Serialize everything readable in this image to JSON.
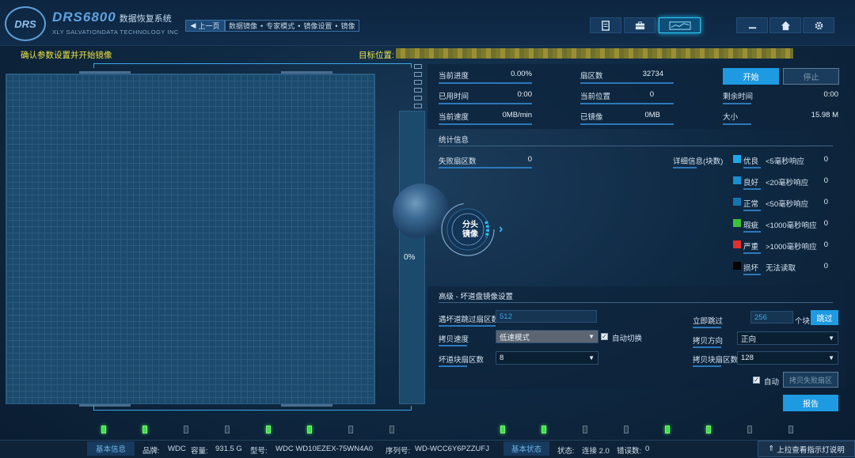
{
  "app": {
    "logo_text": "DRS",
    "name": "DRS6800",
    "name_cn": "数据恢复系统",
    "subtitle": "XLY SALVATIONDATA TECHNOLOGY INC"
  },
  "nav": {
    "back_label": "上一页",
    "breadcrumb": [
      "数据镜像",
      "专家模式",
      "镜像设置",
      "镜像"
    ]
  },
  "toolbar": {
    "icons": [
      "report-icon",
      "toolbox-icon",
      "monitor-icon",
      "minimize-icon",
      "home-icon",
      "settings-icon"
    ]
  },
  "header": {
    "left_note": "确认参数设置并开始镜像",
    "target_label": "目标位置:"
  },
  "progress_panel": {
    "percent_text": "0%",
    "mode_label_line1": "分头",
    "mode_label_line2": "镜像"
  },
  "stats": {
    "current_progress": {
      "label": "当前进度",
      "value": "0.00%"
    },
    "sector_count": {
      "label": "扇区数",
      "value": "32734"
    },
    "elapsed": {
      "label": "已用时间",
      "value": "0:00"
    },
    "current_position": {
      "label": "当前位置",
      "value": "0"
    },
    "remaining": {
      "label": "剩余时间",
      "value": "0:00"
    },
    "current_speed": {
      "label": "当前速度",
      "value": "0MB/min"
    },
    "mirrored": {
      "label": "已镜像",
      "value": "0MB"
    },
    "size": {
      "label": "大小",
      "value": "15.98 M"
    }
  },
  "buttons": {
    "start": "开始",
    "stop": "停止",
    "skip": "跳过",
    "copy_failed": "拷贝失败扇区",
    "report": "报告"
  },
  "statistics": {
    "title": "统计信息",
    "failed_sectors_label": "失败扇区数",
    "failed_sectors_value": "0",
    "detail_label": "详细信息(块数)",
    "legend": [
      {
        "name": "优良",
        "desc": "<5毫秒响应",
        "value": "0",
        "color": "#1fa8e8"
      },
      {
        "name": "良好",
        "desc": "<20毫秒响应",
        "value": "0",
        "color": "#1a8fd0"
      },
      {
        "name": "正常",
        "desc": "<50毫秒响应",
        "value": "0",
        "color": "#1675b0"
      },
      {
        "name": "瑕疵",
        "desc": "<1000毫秒响应",
        "value": "0",
        "color": "#3cc03c"
      },
      {
        "name": "严重",
        "desc": ">1000毫秒响应",
        "value": "0",
        "color": "#e03030"
      },
      {
        "name": "损坏",
        "desc": "无法读取",
        "value": "0",
        "color": "#050505"
      }
    ]
  },
  "advanced": {
    "title": "高级 - 坏道盘镜像设置",
    "skip_sectors_label": "遇坏道跳过扇区数",
    "skip_sectors_value": "512",
    "immediate_skip_label": "立即跳过",
    "immediate_skip_value": "256",
    "block_unit": "个块",
    "copy_speed_label": "拷贝速度",
    "copy_speed_value": "低速模式",
    "auto_switch_label": "自动切换",
    "copy_direction_label": "拷贝方向",
    "copy_direction_value": "正向",
    "bad_block_label": "坏道块扇区数",
    "bad_block_value": "8",
    "copy_block_label": "拷贝块扇区数",
    "copy_block_value": "128",
    "auto_label": "自动"
  },
  "leds": [
    true,
    true,
    false,
    false,
    true,
    true,
    false,
    false,
    true,
    true,
    false,
    false,
    true,
    true,
    false,
    false
  ],
  "statusbar": {
    "basic_info_tab": "基本信息",
    "brand_label": "品牌:",
    "brand_value": "WDC",
    "capacity_label": "容量:",
    "capacity_value": "931.5 G",
    "model_label": "型号:",
    "model_value": "WDC WD10EZEX-75WN4A0",
    "serial_label": "序列号:",
    "serial_value": "WD-WCC6Y6PZZUFJ",
    "basic_status_tab": "基本状态",
    "status_label": "状态:",
    "status_value": "连接 2.0",
    "error_label": "错误数:",
    "error_value": "0",
    "help_label": "上拉查看指示灯说明"
  }
}
